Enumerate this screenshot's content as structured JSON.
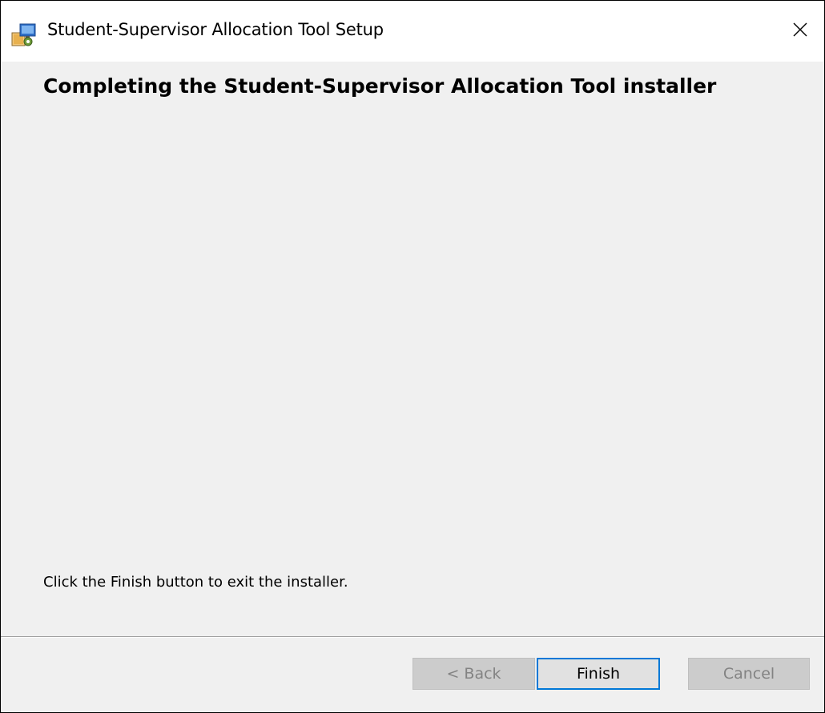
{
  "window": {
    "title": "Student-Supervisor Allocation Tool Setup"
  },
  "content": {
    "heading": "Completing the Student-Supervisor Allocation Tool installer",
    "info": "Click the Finish button to exit the installer."
  },
  "buttons": {
    "back": {
      "label": "< Back",
      "enabled": false
    },
    "finish": {
      "label": "Finish",
      "enabled": true,
      "focused": true
    },
    "cancel": {
      "label": "Cancel",
      "enabled": false
    }
  },
  "icons": {
    "app": "installer-icon",
    "close": "close-icon"
  },
  "colors": {
    "focus_border": "#0078d7",
    "dialog_background": "#f0f0f0",
    "disabled_text": "#838383"
  }
}
